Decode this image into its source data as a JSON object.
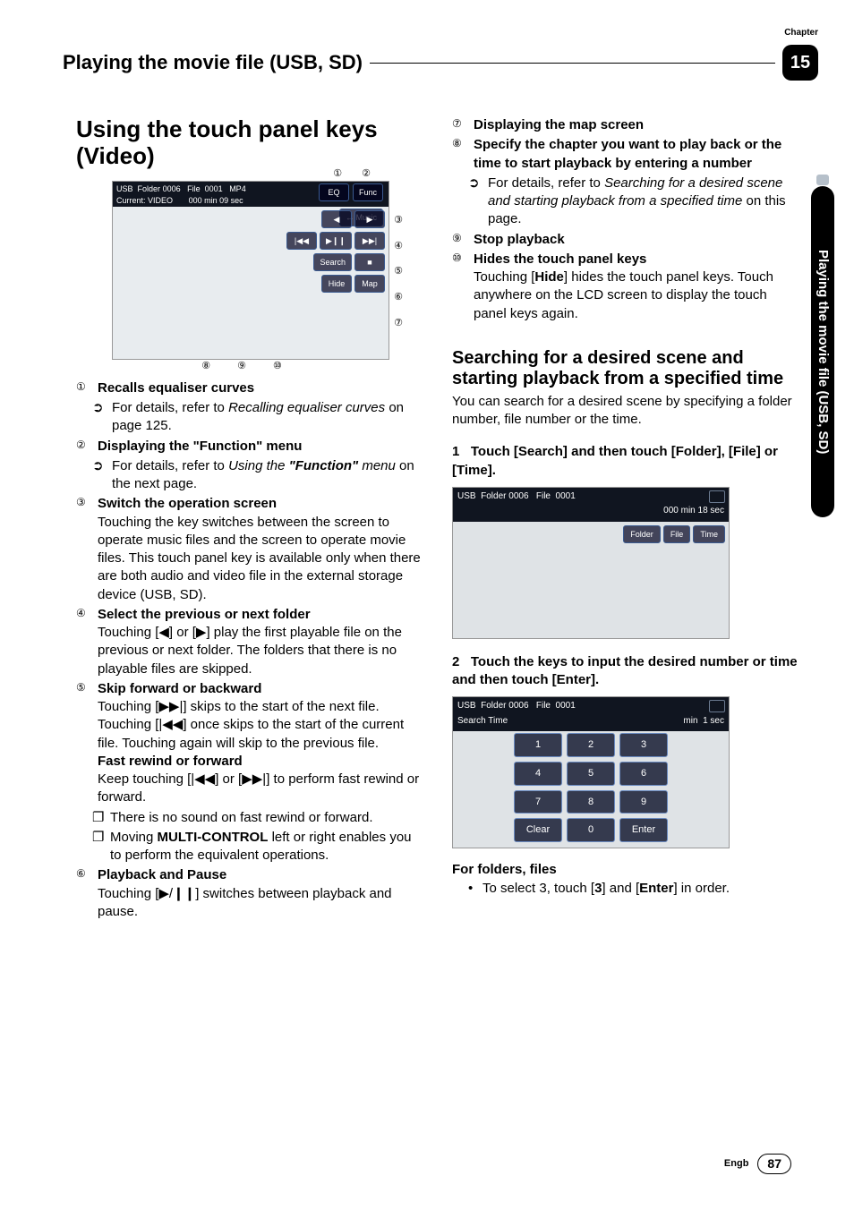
{
  "chapter": {
    "label": "Chapter",
    "number": "15"
  },
  "header_title": "Playing the movie file (USB, SD)",
  "side_tab": "Playing the movie file (USB, SD)",
  "footer": {
    "lang": "Engb",
    "page": "87"
  },
  "left": {
    "h1": "Using the touch panel keys (Video)",
    "figure": {
      "usb": "USB",
      "folder_label": "Folder",
      "folder_num": "0006",
      "file_label": "File",
      "file_num": "0001",
      "format": "MP4",
      "current_label": "Current:",
      "current_val": "VIDEO",
      "time": "000 min 09 sec",
      "music": "↔ Music",
      "eq": "EQ",
      "func": "Func",
      "search": "Search",
      "hide": "Hide",
      "map": "Map",
      "top_callouts": [
        "①",
        "②"
      ],
      "right_callouts": [
        "③",
        "④",
        "⑤",
        "⑥",
        "⑦"
      ],
      "bottom_callouts": [
        "⑧",
        "⑨",
        "⑩"
      ]
    },
    "items": [
      {
        "n": "①",
        "title": "Recalls equaliser curves",
        "sub": {
          "prefix": "➲",
          "lead": "For details, refer to ",
          "ital": "Recalling equaliser curves",
          "tail": " on page 125."
        }
      },
      {
        "n": "②",
        "title": "Displaying the \"Function\" menu",
        "sub": {
          "prefix": "➲",
          "lead": "For details, refer to ",
          "ital": "Using the ",
          "bold_quote": "\"Function\"",
          "ital2": " menu",
          "tail": " on the next page."
        }
      },
      {
        "n": "③",
        "title": "Switch the operation screen",
        "body": "Touching the key switches between the screen to operate music files and the screen to operate movie files. This touch panel key is available only when there are both audio and video file in the external storage device (USB, SD)."
      },
      {
        "n": "④",
        "title": "Select the previous or next folder",
        "body": "Touching [◀] or [▶] play the first playable file on the previous or next folder. The folders that there is no playable files are skipped."
      },
      {
        "n": "⑤",
        "title": "Skip forward or backward",
        "body": "Touching [▶▶|] skips to the start of the next file. Touching [|◀◀] once skips to the start of the current file. Touching again will skip to the previous file.",
        "subtitle": "Fast rewind or forward",
        "body2": "Keep touching [|◀◀] or [▶▶|] to perform fast rewind or forward.",
        "box1": "There is no sound on fast rewind or forward.",
        "box2_pre": "Moving ",
        "box2_bold": "MULTI-CONTROL",
        "box2_post": " left or right enables you to perform the equivalent operations."
      },
      {
        "n": "⑥",
        "title": "Playback and Pause",
        "body": "Touching [▶/❙❙] switches between playback and pause."
      }
    ]
  },
  "right": {
    "items": [
      {
        "n": "⑦",
        "title": "Displaying the map screen"
      },
      {
        "n": "⑧",
        "title": "Specify the chapter you want to play back or the time to start playback by entering a number",
        "sub": {
          "prefix": "➲",
          "lead": "For details, refer to ",
          "ital": "Searching for a desired scene and starting playback from a specified time",
          "tail": " on this page."
        }
      },
      {
        "n": "⑨",
        "title": "Stop playback"
      },
      {
        "n": "⑩",
        "title": "Hides the touch panel keys",
        "body_pre": "Touching [",
        "body_bold": "Hide",
        "body_post": "] hides the touch panel keys. Touch anywhere on the LCD screen to display the touch panel keys again."
      }
    ],
    "h2": "Searching for a desired scene and starting playback from a specified time",
    "h2_body": "You can search for a desired scene by specifying a folder number, file number or the time.",
    "step1": {
      "n": "1",
      "text": "Touch [Search] and then touch [Folder], [File] or [Time]."
    },
    "figure2": {
      "usb": "USB",
      "folder_label": "Folder",
      "folder_num": "0006",
      "file_label": "File",
      "file_num": "0001",
      "time": "000 min 18 sec",
      "tabs": [
        "Folder",
        "File",
        "Time"
      ]
    },
    "step2": {
      "n": "2",
      "text": "Touch the keys to input the desired number or time and then touch [Enter]."
    },
    "figure3": {
      "usb": "USB",
      "folder_label": "Folder",
      "folder_num": "0006",
      "file_label": "File",
      "file_num": "0001",
      "search_time": "Search Time",
      "min": "min",
      "sec": "1 sec",
      "keys": [
        "1",
        "2",
        "3",
        "4",
        "5",
        "6",
        "7",
        "8",
        "9",
        "Clear",
        "0",
        "Enter"
      ]
    },
    "folders_heading": "For folders, files",
    "folders_bullet_pre": "To select 3, touch [",
    "folders_bullet_b1": "3",
    "folders_bullet_mid": "] and [",
    "folders_bullet_b2": "Enter",
    "folders_bullet_post": "] in order."
  }
}
